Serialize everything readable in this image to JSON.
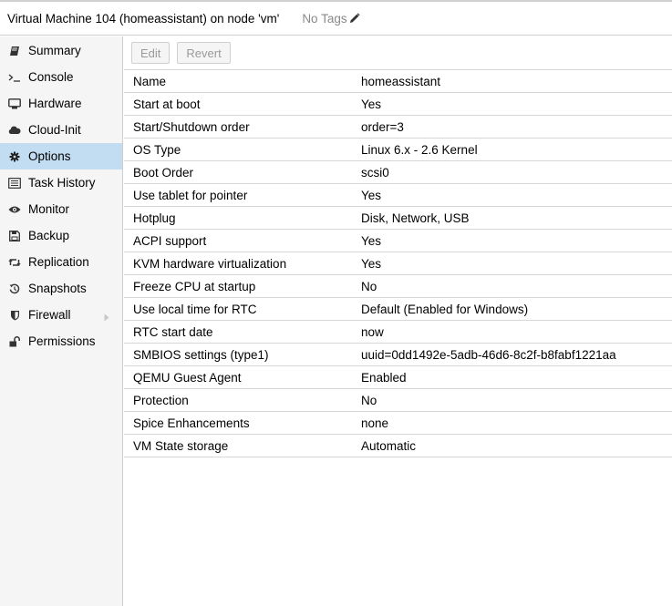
{
  "header": {
    "title": "Virtual Machine 104 (homeassistant) on node 'vm'",
    "tags_label": "No Tags"
  },
  "sidebar": {
    "items": [
      {
        "label": "Summary",
        "icon": "book-icon"
      },
      {
        "label": "Console",
        "icon": "terminal-icon"
      },
      {
        "label": "Hardware",
        "icon": "desktop-icon"
      },
      {
        "label": "Cloud-Init",
        "icon": "cloud-icon"
      },
      {
        "label": "Options",
        "icon": "gear-icon",
        "active": true
      },
      {
        "label": "Task History",
        "icon": "list-icon"
      },
      {
        "label": "Monitor",
        "icon": "eye-icon"
      },
      {
        "label": "Backup",
        "icon": "floppy-icon"
      },
      {
        "label": "Replication",
        "icon": "retweet-icon"
      },
      {
        "label": "Snapshots",
        "icon": "history-icon"
      },
      {
        "label": "Firewall",
        "icon": "shield-icon",
        "expandable": true
      },
      {
        "label": "Permissions",
        "icon": "unlock-icon"
      }
    ]
  },
  "toolbar": {
    "edit_label": "Edit",
    "revert_label": "Revert"
  },
  "options": [
    {
      "name": "Name",
      "value": "homeassistant"
    },
    {
      "name": "Start at boot",
      "value": "Yes"
    },
    {
      "name": "Start/Shutdown order",
      "value": "order=3"
    },
    {
      "name": "OS Type",
      "value": "Linux 6.x - 2.6 Kernel"
    },
    {
      "name": "Boot Order",
      "value": "scsi0"
    },
    {
      "name": "Use tablet for pointer",
      "value": "Yes"
    },
    {
      "name": "Hotplug",
      "value": "Disk, Network, USB"
    },
    {
      "name": "ACPI support",
      "value": "Yes"
    },
    {
      "name": "KVM hardware virtualization",
      "value": "Yes"
    },
    {
      "name": "Freeze CPU at startup",
      "value": "No"
    },
    {
      "name": "Use local time for RTC",
      "value": "Default (Enabled for Windows)"
    },
    {
      "name": "RTC start date",
      "value": "now"
    },
    {
      "name": "SMBIOS settings (type1)",
      "value": "uuid=0dd1492e-5adb-46d6-8c2f-b8fabf1221aa"
    },
    {
      "name": "QEMU Guest Agent",
      "value": "Enabled"
    },
    {
      "name": "Protection",
      "value": "No"
    },
    {
      "name": "Spice Enhancements",
      "value": "none"
    },
    {
      "name": "VM State storage",
      "value": "Automatic"
    }
  ],
  "colors": {
    "active_nav_bg": "#c2ddf2",
    "sidebar_bg": "#f5f5f5",
    "border": "#cfcfcf",
    "muted_text": "#8a8a8a"
  }
}
